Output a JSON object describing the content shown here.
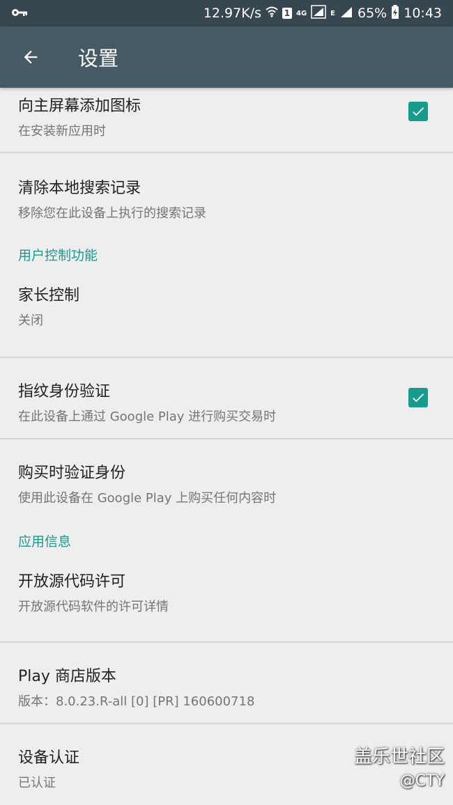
{
  "status_bar": {
    "speed": "12.97K/s",
    "sim": "1",
    "network_4g": "4G",
    "network_e": "E",
    "battery": "65%",
    "time": "10:43"
  },
  "app_bar": {
    "title": "设置"
  },
  "settings": {
    "add_icon": {
      "title": "向主屏幕添加图标",
      "subtitle": "在安装新应用时",
      "checked": true
    },
    "clear_history": {
      "title": "清除本地搜索记录",
      "subtitle": "移除您在此设备上执行的搜索记录"
    },
    "section_user_controls": "用户控制功能",
    "parental": {
      "title": "家长控制",
      "subtitle": "关闭"
    },
    "fingerprint": {
      "title": "指纹身份验证",
      "subtitle": "在此设备上通过 Google Play 进行购买交易时",
      "checked": true
    },
    "purchase_auth": {
      "title": "购买时验证身份",
      "subtitle": "使用此设备在 Google Play 上购买任何内容时"
    },
    "section_app_info": "应用信息",
    "open_source": {
      "title": "开放源代码许可",
      "subtitle": "开放源代码软件的许可详情"
    },
    "version": {
      "title": "Play 商店版本",
      "subtitle": "版本：8.0.23.R-all [0] [PR] 160600718"
    },
    "certification": {
      "title": "设备认证",
      "subtitle": "已认证"
    }
  },
  "watermark": {
    "line1": "盖乐世社区",
    "line2": "@CTY"
  },
  "colors": {
    "status_bar": "#37474f",
    "app_bar": "#455a64",
    "accent": "#159c8c",
    "background": "#eeeeee"
  }
}
